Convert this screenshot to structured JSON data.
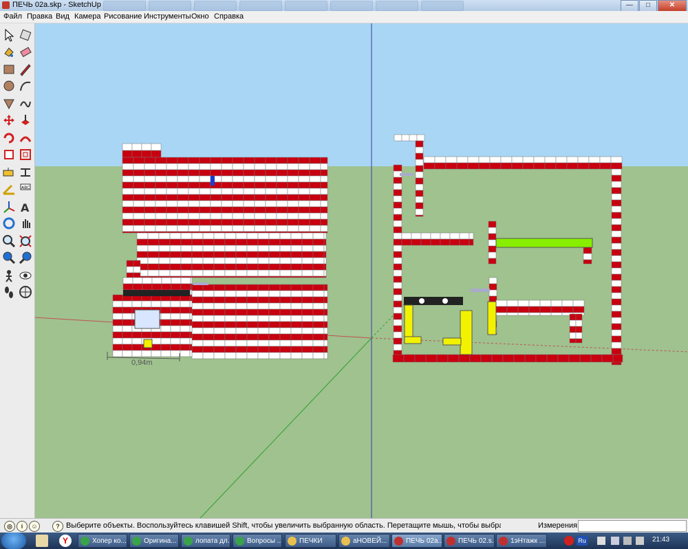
{
  "window": {
    "title": "ПЕЧЬ 02а.skp - SketchUp",
    "buttons": [
      "—",
      "□",
      "✕"
    ]
  },
  "menu": [
    "Файл",
    "Правка",
    "Вид",
    "Камера",
    "Рисование",
    "Инструменты",
    "Окно",
    "Справка"
  ],
  "tools": [
    "select-tool-icon",
    "component-tool-icon",
    "paint-bucket-icon",
    "eraser-icon",
    "rectangle-tool-icon",
    "pencil-line-icon",
    "circle-tool-icon",
    "arc-tool-icon",
    "polygon-tool-icon",
    "freehand-tool-icon",
    "move-tool-icon",
    "push-pull-icon",
    "rotate-tool-icon",
    "follow-me-icon",
    "scale-tool-icon",
    "offset-tool-icon",
    "tape-measure-icon",
    "dimension-icon",
    "protractor-icon",
    "text-tool-icon",
    "axes-tool-icon",
    "3d-text-icon",
    "orbit-icon",
    "pan-icon",
    "zoom-icon",
    "zoom-extents-icon",
    "previous-view-icon",
    "next-view-icon",
    "walk-icon",
    "look-around-icon",
    "footprints-icon",
    "position-camera-icon"
  ],
  "viewport": {
    "dimension_label": "0,94m",
    "sky_color": "#a9d6f4",
    "ground_color": "#9fc28f",
    "brick_red": "#c8000f",
    "brick_white": "#ffffff",
    "brick_yellow": "#f2f200",
    "brick_green": "#88ee00"
  },
  "status": {
    "text": "Выберите объекты. Воспользуйтесь клавишей Shift, чтобы увеличить выбранную область. Перетащите мышь, чтобы выбрать нескол",
    "measure_label": "Измерения",
    "measure_value": ""
  },
  "taskbar": {
    "buttons": [
      {
        "label": "Хопер ко..."
      },
      {
        "label": "Оригина..."
      },
      {
        "label": "лопата дл..."
      },
      {
        "label": "Вопросы ..."
      },
      {
        "label": "ПЕЧКИ"
      },
      {
        "label": "аНОВЕЙ..."
      },
      {
        "label": "ПЕЧЬ 02а...."
      },
      {
        "label": "ПЕЧЬ 02.s..."
      },
      {
        "label": "1эНтажк ..."
      }
    ],
    "lang": "Ru",
    "clock": "21:43"
  }
}
